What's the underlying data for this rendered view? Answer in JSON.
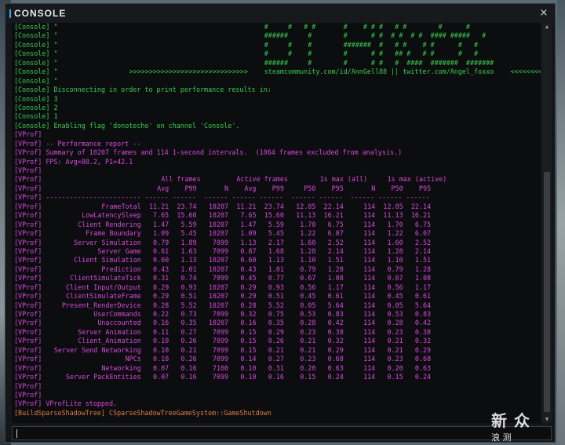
{
  "window": {
    "title": "CONSOLE",
    "close_glyph": "×"
  },
  "console_prefix": "[Console]",
  "vprof_prefix": "[VProf]",
  "build_prefix": "[BuildSparseShadowTree]",
  "banner_lines": [
    {
      "left": "\"",
      "right": "#     #   # #       #    # # #   # #        #      #"
    },
    {
      "left": "\"",
      "right": "######     #        #      # #  # #  # #  #### #####   #"
    },
    {
      "left": "\"",
      "right": "#     #    #        #######  #   # #    # #      #   #"
    },
    {
      "left": "\"",
      "right": "#     #    #        #      # #   ## #   # #      #   #"
    },
    {
      "left": "\"",
      "right": "######     #        #      # #   #  ####  #######  #######"
    },
    {
      "left": "\"",
      "arrows_left": ">>>>>>>>>>>>>>>>>>>>>>>>>>>>>>",
      "right": "steamcommunity.com/id/AnnGell88 || twitter.com/Angel_foxxo",
      "arrows_right": "<<<<<<<<<<<<"
    },
    {
      "left": "\"",
      "right": ""
    }
  ],
  "console_messages": [
    "Disconnecting in order to print performance results in:",
    "3",
    "2",
    "1",
    "Enabling flag 'donotecho' on channel 'Console'."
  ],
  "report_header": [
    "",
    "-- Performance report --",
    "Summary of 10207 frames and 114 1-second intervals.  (1064 frames excluded from analysis.)",
    "FPS: Avg=88.2, P1=42.1",
    ""
  ],
  "group_headers": [
    "All frames",
    "Active frames",
    "1s max (all)",
    "1s max (active)"
  ],
  "column_headers": [
    "Avg",
    "P99",
    "N",
    "Avg",
    "P99",
    "P50",
    "P95",
    "N",
    "P50",
    "P95"
  ],
  "separator_line": "------------------------ ------ ------  ------ ------ ------  ------ ------  ------ ------ ------",
  "rows": [
    {
      "name": "FrameTotal",
      "v": [
        "11.21",
        "23.74",
        "10207",
        "11.21",
        "23.74",
        "12.85",
        "22.14",
        "114",
        "12.85",
        "22.14"
      ]
    },
    {
      "name": "LowLatencySleep",
      "v": [
        "7.65",
        "15.60",
        "10207",
        "7.65",
        "15.60",
        "11.13",
        "16.21",
        "114",
        "11.13",
        "16.21"
      ]
    },
    {
      "name": "Client Rendering",
      "v": [
        "1.47",
        "5.59",
        "10207",
        "1.47",
        "5.59",
        "1.70",
        "6.75",
        "114",
        "1.70",
        "6.75"
      ]
    },
    {
      "name": "Frame Boundary",
      "v": [
        "1.09",
        "5.45",
        "10207",
        "1.09",
        "5.45",
        "1.22",
        "6.07",
        "114",
        "1.22",
        "6.07"
      ]
    },
    {
      "name": "Server Simulation",
      "v": [
        "0.79",
        "1.89",
        "7099",
        "1.13",
        "2.17",
        "1.60",
        "2.52",
        "114",
        "1.60",
        "2.52"
      ]
    },
    {
      "name": "Server Game",
      "v": [
        "0.61",
        "1.63",
        "7099",
        "0.87",
        "1.68",
        "1.28",
        "2.14",
        "114",
        "1.28",
        "2.14"
      ]
    },
    {
      "name": "Client Simulation",
      "v": [
        "0.60",
        "1.13",
        "10207",
        "0.60",
        "1.13",
        "1.10",
        "1.51",
        "114",
        "1.10",
        "1.51"
      ]
    },
    {
      "name": "Prediction",
      "v": [
        "0.43",
        "1.01",
        "10207",
        "0.43",
        "1.01",
        "0.79",
        "1.28",
        "114",
        "0.79",
        "1.28"
      ]
    },
    {
      "name": "ClientSimulateTick",
      "v": [
        "0.31",
        "0.74",
        "7099",
        "0.45",
        "0.77",
        "0.67",
        "1.08",
        "114",
        "0.67",
        "1.08"
      ]
    },
    {
      "name": "Client Input/Output",
      "v": [
        "0.29",
        "0.93",
        "10207",
        "0.29",
        "0.93",
        "0.56",
        "1.17",
        "114",
        "0.56",
        "1.17"
      ]
    },
    {
      "name": "ClientSimulateFrame",
      "v": [
        "0.29",
        "0.51",
        "10207",
        "0.29",
        "0.51",
        "0.45",
        "0.61",
        "114",
        "0.45",
        "0.61"
      ]
    },
    {
      "name": "Present_RenderDevice",
      "v": [
        "0.28",
        "5.52",
        "10207",
        "0.28",
        "5.52",
        "0.05",
        "5.64",
        "114",
        "0.05",
        "5.64"
      ]
    },
    {
      "name": "UserCommands",
      "v": [
        "0.22",
        "0.73",
        "7099",
        "0.32",
        "0.75",
        "0.53",
        "0.83",
        "114",
        "0.53",
        "0.83"
      ]
    },
    {
      "name": "Unaccounted",
      "v": [
        "0.16",
        "0.35",
        "10207",
        "0.16",
        "0.35",
        "0.28",
        "0.42",
        "114",
        "0.28",
        "0.42"
      ]
    },
    {
      "name": "Server Animation",
      "v": [
        "0.11",
        "0.27",
        "7099",
        "0.15",
        "0.29",
        "0.23",
        "0.38",
        "114",
        "0.23",
        "0.38"
      ]
    },
    {
      "name": "Client_Animation",
      "v": [
        "0.10",
        "0.26",
        "7099",
        "0.15",
        "0.26",
        "0.21",
        "0.32",
        "114",
        "0.21",
        "0.32"
      ]
    },
    {
      "name": "Server Send Networking",
      "v": [
        "0.10",
        "0.21",
        "7099",
        "0.15",
        "0.21",
        "0.21",
        "0.29",
        "114",
        "0.21",
        "0.29"
      ]
    },
    {
      "name": "NPCs",
      "v": [
        "0.10",
        "0.26",
        "7099",
        "0.14",
        "0.27",
        "0.23",
        "0.68",
        "114",
        "0.23",
        "0.68"
      ]
    },
    {
      "name": "Networking",
      "v": [
        "0.07",
        "0.16",
        "7100",
        "0.10",
        "0.31",
        "0.20",
        "0.63",
        "114",
        "0.20",
        "0.63"
      ]
    },
    {
      "name": "Server PackEntities",
      "v": [
        "0.07",
        "0.16",
        "7099",
        "0.10",
        "0.16",
        "0.15",
        "0.24",
        "114",
        "0.15",
        "0.24"
      ]
    }
  ],
  "footer_vprof": [
    "",
    "",
    "VProfLite stopped."
  ],
  "build_message": "CSparseShadowTreeGameSystem::GameShutdown",
  "input": {
    "value": "",
    "placeholder": ""
  },
  "watermark": {
    "big": "新 众",
    "small": "浪 测"
  }
}
